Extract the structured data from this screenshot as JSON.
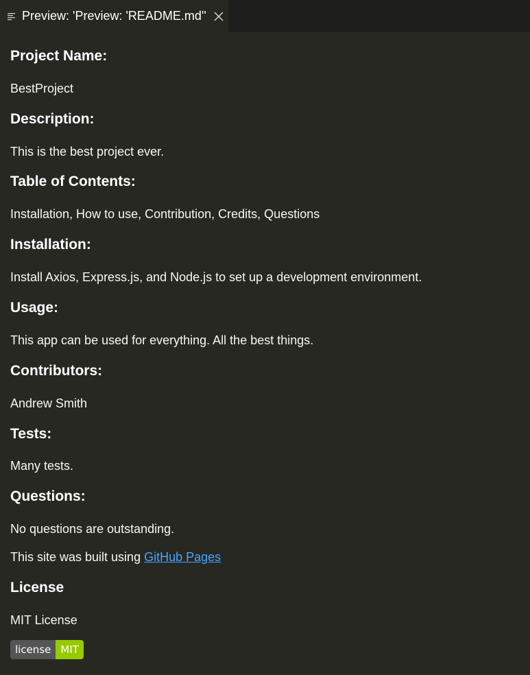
{
  "tab": {
    "title": "Preview: 'Preview: 'README.md''"
  },
  "readme": {
    "project_name_heading": "Project Name:",
    "project_name": "BestProject",
    "description_heading": "Description:",
    "description": "This is the best project ever.",
    "toc_heading": "Table of Contents:",
    "toc": "Installation, How to use, Contribution, Credits, Questions",
    "installation_heading": "Installation:",
    "installation": "Install Axios, Express.js, and Node.js to set up a development environment.",
    "usage_heading": "Usage:",
    "usage": "This app can be used for everything. All the best things.",
    "contributors_heading": "Contributors:",
    "contributors": "Andrew Smith",
    "tests_heading": "Tests:",
    "tests": "Many tests.",
    "questions_heading": "Questions:",
    "questions": "No questions are outstanding.",
    "built_using_prefix": "This site was built using ",
    "built_using_link": "GitHub Pages",
    "license_heading": "License",
    "license": "MIT License",
    "badge_label": "license",
    "badge_value": "MIT"
  },
  "colors": {
    "background": "#272822",
    "tabbar": "#1e1f1c",
    "link": "#4aa3ff",
    "badge_left": "#555555",
    "badge_right": "#97ca00"
  }
}
